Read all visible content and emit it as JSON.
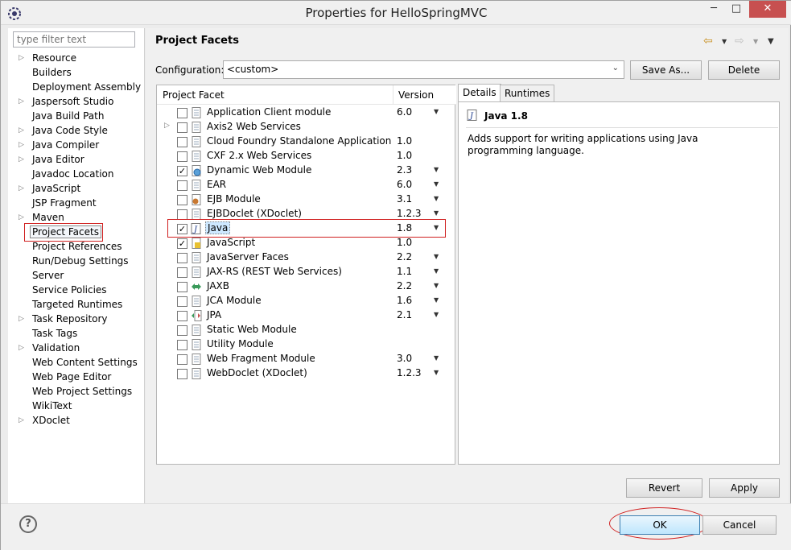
{
  "window": {
    "title": "Properties for HelloSpringMVC"
  },
  "titlebar": {
    "minimize": "─",
    "maximize": "□",
    "close": "✕"
  },
  "sidebar": {
    "filter_placeholder": "type filter text",
    "items": [
      {
        "label": "Resource",
        "expandable": true
      },
      {
        "label": "Builders",
        "expandable": false
      },
      {
        "label": "Deployment Assembly",
        "expandable": false
      },
      {
        "label": "Jaspersoft Studio",
        "expandable": true
      },
      {
        "label": "Java Build Path",
        "expandable": false
      },
      {
        "label": "Java Code Style",
        "expandable": true
      },
      {
        "label": "Java Compiler",
        "expandable": true
      },
      {
        "label": "Java Editor",
        "expandable": true
      },
      {
        "label": "Javadoc Location",
        "expandable": false
      },
      {
        "label": "JavaScript",
        "expandable": true
      },
      {
        "label": "JSP Fragment",
        "expandable": false
      },
      {
        "label": "Maven",
        "expandable": true
      },
      {
        "label": "Project Facets",
        "expandable": false,
        "selected": true
      },
      {
        "label": "Project References",
        "expandable": false
      },
      {
        "label": "Run/Debug Settings",
        "expandable": false
      },
      {
        "label": "Server",
        "expandable": false
      },
      {
        "label": "Service Policies",
        "expandable": false
      },
      {
        "label": "Targeted Runtimes",
        "expandable": false
      },
      {
        "label": "Task Repository",
        "expandable": true
      },
      {
        "label": "Task Tags",
        "expandable": false
      },
      {
        "label": "Validation",
        "expandable": true
      },
      {
        "label": "Web Content Settings",
        "expandable": false
      },
      {
        "label": "Web Page Editor",
        "expandable": false
      },
      {
        "label": "Web Project Settings",
        "expandable": false
      },
      {
        "label": "WikiText",
        "expandable": false
      },
      {
        "label": "XDoclet",
        "expandable": true
      }
    ]
  },
  "main": {
    "page_title": "Project Facets",
    "configuration_label": "Configuration:",
    "configuration_value": "<custom>",
    "save_as_label": "Save As...",
    "delete_label": "Delete",
    "revert_label": "Revert",
    "apply_label": "Apply"
  },
  "facets_table": {
    "col_facet": "Project Facet",
    "col_version": "Version",
    "rows": [
      {
        "name": "Application Client module",
        "version": "6.0",
        "checked": false,
        "dropdown": true,
        "expandable": false,
        "icon": "page-icon"
      },
      {
        "name": "Axis2 Web Services",
        "version": "",
        "checked": false,
        "dropdown": false,
        "expandable": true,
        "icon": "page-icon"
      },
      {
        "name": "Cloud Foundry Standalone Application",
        "version": "1.0",
        "checked": false,
        "dropdown": false,
        "expandable": false,
        "icon": "page-icon"
      },
      {
        "name": "CXF 2.x Web Services",
        "version": "1.0",
        "checked": false,
        "dropdown": false,
        "expandable": false,
        "icon": "page-icon"
      },
      {
        "name": "Dynamic Web Module",
        "version": "2.3",
        "checked": true,
        "dropdown": true,
        "expandable": false,
        "icon": "globe-page-icon"
      },
      {
        "name": "EAR",
        "version": "6.0",
        "checked": false,
        "dropdown": true,
        "expandable": false,
        "icon": "page-icon"
      },
      {
        "name": "EJB Module",
        "version": "3.1",
        "checked": false,
        "dropdown": true,
        "expandable": false,
        "icon": "bean-page-icon"
      },
      {
        "name": "EJBDoclet (XDoclet)",
        "version": "1.2.3",
        "checked": false,
        "dropdown": true,
        "expandable": false,
        "icon": "page-icon"
      },
      {
        "name": "Java",
        "version": "1.8",
        "checked": true,
        "dropdown": true,
        "expandable": false,
        "icon": "java-icon",
        "selected": true
      },
      {
        "name": "JavaScript",
        "version": "1.0",
        "checked": true,
        "dropdown": false,
        "expandable": false,
        "icon": "js-page-icon"
      },
      {
        "name": "JavaServer Faces",
        "version": "2.2",
        "checked": false,
        "dropdown": true,
        "expandable": false,
        "icon": "page-icon"
      },
      {
        "name": "JAX-RS (REST Web Services)",
        "version": "1.1",
        "checked": false,
        "dropdown": true,
        "expandable": false,
        "icon": "page-icon"
      },
      {
        "name": "JAXB",
        "version": "2.2",
        "checked": false,
        "dropdown": true,
        "expandable": false,
        "icon": "arrows-icon"
      },
      {
        "name": "JCA Module",
        "version": "1.6",
        "checked": false,
        "dropdown": true,
        "expandable": false,
        "icon": "page-icon"
      },
      {
        "name": "JPA",
        "version": "2.1",
        "checked": false,
        "dropdown": true,
        "expandable": false,
        "icon": "arrows-page-icon"
      },
      {
        "name": "Static Web Module",
        "version": "",
        "checked": false,
        "dropdown": false,
        "expandable": false,
        "icon": "page-icon"
      },
      {
        "name": "Utility Module",
        "version": "",
        "checked": false,
        "dropdown": false,
        "expandable": false,
        "icon": "page-icon"
      },
      {
        "name": "Web Fragment Module",
        "version": "3.0",
        "checked": false,
        "dropdown": true,
        "expandable": false,
        "icon": "page-icon"
      },
      {
        "name": "WebDoclet (XDoclet)",
        "version": "1.2.3",
        "checked": false,
        "dropdown": true,
        "expandable": false,
        "icon": "page-icon"
      }
    ]
  },
  "details": {
    "tab_details": "Details",
    "tab_runtimes": "Runtimes",
    "title": "Java 1.8",
    "description": "Adds support for writing applications using Java programming language."
  },
  "footer": {
    "help": "?",
    "ok_label": "OK",
    "cancel_label": "Cancel"
  },
  "colors": {
    "annotation_red": "#d02020",
    "selection_blue": "#cde8ff",
    "close_button": "#c75050"
  }
}
